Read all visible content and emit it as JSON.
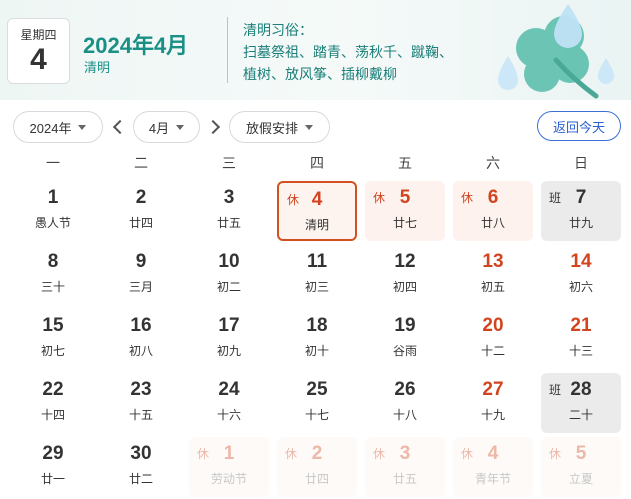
{
  "header": {
    "weekday": "星期四",
    "day": "4",
    "year_month": "2024年4月",
    "solar_term": "清明",
    "customs_title": "清明习俗：",
    "customs_line1": "扫墓祭祖、踏青、荡秋千、蹴鞠、",
    "customs_line2": "植树、放风筝、插柳戴柳"
  },
  "toolbar": {
    "year_select": "2024年",
    "month_select": "4月",
    "holiday_select": "放假安排",
    "today_button": "返回今天"
  },
  "weekdays": [
    "一",
    "二",
    "三",
    "四",
    "五",
    "六",
    "日"
  ],
  "rest_tag": "休",
  "work_tag": "班",
  "days": [
    {
      "num": "1",
      "lunar": "愚人节",
      "type": ""
    },
    {
      "num": "2",
      "lunar": "廿四",
      "type": ""
    },
    {
      "num": "3",
      "lunar": "廿五",
      "type": ""
    },
    {
      "num": "4",
      "lunar": "清明",
      "type": "rest current"
    },
    {
      "num": "5",
      "lunar": "廿七",
      "type": "rest"
    },
    {
      "num": "6",
      "lunar": "廿八",
      "type": "rest"
    },
    {
      "num": "7",
      "lunar": "廿九",
      "type": "work"
    },
    {
      "num": "8",
      "lunar": "三十",
      "type": ""
    },
    {
      "num": "9",
      "lunar": "三月",
      "type": ""
    },
    {
      "num": "10",
      "lunar": "初二",
      "type": ""
    },
    {
      "num": "11",
      "lunar": "初三",
      "type": ""
    },
    {
      "num": "12",
      "lunar": "初四",
      "type": ""
    },
    {
      "num": "13",
      "lunar": "初五",
      "type": "weekend"
    },
    {
      "num": "14",
      "lunar": "初六",
      "type": "weekend"
    },
    {
      "num": "15",
      "lunar": "初七",
      "type": ""
    },
    {
      "num": "16",
      "lunar": "初八",
      "type": ""
    },
    {
      "num": "17",
      "lunar": "初九",
      "type": ""
    },
    {
      "num": "18",
      "lunar": "初十",
      "type": ""
    },
    {
      "num": "19",
      "lunar": "谷雨",
      "type": ""
    },
    {
      "num": "20",
      "lunar": "十二",
      "type": "weekend"
    },
    {
      "num": "21",
      "lunar": "十三",
      "type": "weekend"
    },
    {
      "num": "22",
      "lunar": "十四",
      "type": ""
    },
    {
      "num": "23",
      "lunar": "十五",
      "type": ""
    },
    {
      "num": "24",
      "lunar": "十六",
      "type": ""
    },
    {
      "num": "25",
      "lunar": "十七",
      "type": ""
    },
    {
      "num": "26",
      "lunar": "十八",
      "type": ""
    },
    {
      "num": "27",
      "lunar": "十九",
      "type": "weekend"
    },
    {
      "num": "28",
      "lunar": "二十",
      "type": "work"
    },
    {
      "num": "29",
      "lunar": "廿一",
      "type": ""
    },
    {
      "num": "30",
      "lunar": "廿二",
      "type": ""
    },
    {
      "num": "1",
      "lunar": "劳动节",
      "type": "other rest"
    },
    {
      "num": "2",
      "lunar": "廿四",
      "type": "other rest"
    },
    {
      "num": "3",
      "lunar": "廿五",
      "type": "other rest"
    },
    {
      "num": "4",
      "lunar": "青年节",
      "type": "other rest"
    },
    {
      "num": "5",
      "lunar": "立夏",
      "type": "other rest"
    }
  ],
  "colors": {
    "accent_teal": "#1a8f86",
    "holiday_red": "#d2441f",
    "link_blue": "#2a5fd0"
  }
}
